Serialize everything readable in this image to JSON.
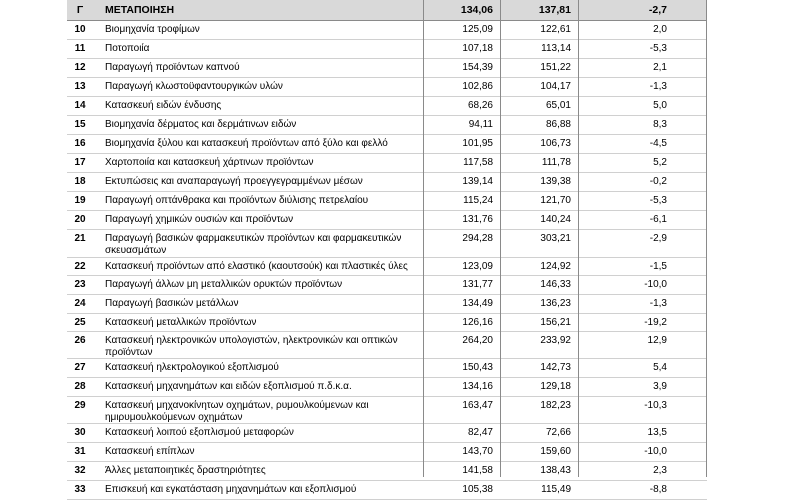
{
  "header": {
    "code": "Γ",
    "name": "ΜΕΤΑΠΟΙΗΣΗ",
    "v1": "134,06",
    "v2": "137,81",
    "v3": "-2,7"
  },
  "rows": [
    {
      "code": "10",
      "name": "Βιομηχανία τροφίμων",
      "v1": "125,09",
      "v2": "122,61",
      "v3": "2,0"
    },
    {
      "code": "11",
      "name": "Ποτοποιία",
      "v1": "107,18",
      "v2": "113,14",
      "v3": "-5,3"
    },
    {
      "code": "12",
      "name": "Παραγωγή προϊόντων καπνού",
      "v1": "154,39",
      "v2": "151,22",
      "v3": "2,1"
    },
    {
      "code": "13",
      "name": "Παραγωγή κλωστοϋφαντουργικών υλών",
      "v1": "102,86",
      "v2": "104,17",
      "v3": "-1,3"
    },
    {
      "code": "14",
      "name": "Κατασκευή ειδών ένδυσης",
      "v1": "68,26",
      "v2": "65,01",
      "v3": "5,0"
    },
    {
      "code": "15",
      "name": "Βιομηχανία δέρματος και δερμάτινων ειδών",
      "v1": "94,11",
      "v2": "86,88",
      "v3": "8,3"
    },
    {
      "code": "16",
      "name": "Βιομηχανία ξύλου και κατασκευή προϊόντων από ξύλο και φελλό",
      "v1": "101,95",
      "v2": "106,73",
      "v3": "-4,5"
    },
    {
      "code": "17",
      "name": "Χαρτοποιία και κατασκευή χάρτινων προϊόντων",
      "v1": "117,58",
      "v2": "111,78",
      "v3": "5,2"
    },
    {
      "code": "18",
      "name": "Εκτυπώσεις και αναπαραγωγή προεγγεγραμμένων μέσων",
      "v1": "139,14",
      "v2": "139,38",
      "v3": "-0,2"
    },
    {
      "code": "19",
      "name": "Παραγωγή οπτάνθρακα και προϊόντων διύλισης πετρελαίου",
      "v1": "115,24",
      "v2": "121,70",
      "v3": "-5,3"
    },
    {
      "code": "20",
      "name": "Παραγωγή χημικών ουσιών και προϊόντων",
      "v1": "131,76",
      "v2": "140,24",
      "v3": "-6,1"
    },
    {
      "code": "21",
      "name": "Παραγωγή βασικών φαρμακευτικών προϊόντων και φαρμακευτικών σκευασμάτων",
      "v1": "294,28",
      "v2": "303,21",
      "v3": "-2,9"
    },
    {
      "code": "22",
      "name": "Κατασκευή προϊόντων από ελαστικό (καουτσούκ) και πλαστικές ύλες",
      "v1": "123,09",
      "v2": "124,92",
      "v3": "-1,5"
    },
    {
      "code": "23",
      "name": "Παραγωγή άλλων μη μεταλλικών ορυκτών προϊόντων",
      "v1": "131,77",
      "v2": "146,33",
      "v3": "-10,0"
    },
    {
      "code": "24",
      "name": "Παραγωγή βασικών μετάλλων",
      "v1": "134,49",
      "v2": "136,23",
      "v3": "-1,3"
    },
    {
      "code": "25",
      "name": "Κατασκευή μεταλλικών προϊόντων",
      "v1": "126,16",
      "v2": "156,21",
      "v3": "-19,2"
    },
    {
      "code": "26",
      "name": "Κατασκευή ηλεκτρονικών υπολογιστών, ηλεκτρονικών και οπτικών προϊόντων",
      "v1": "264,20",
      "v2": "233,92",
      "v3": "12,9"
    },
    {
      "code": "27",
      "name": "Κατασκευή ηλεκτρολογικού εξοπλισμού",
      "v1": "150,43",
      "v2": "142,73",
      "v3": "5,4"
    },
    {
      "code": "28",
      "name": "Κατασκευή μηχανημάτων και ειδών εξοπλισμού π.δ.κ.α.",
      "v1": "134,16",
      "v2": "129,18",
      "v3": "3,9"
    },
    {
      "code": "29",
      "name": "Κατασκευή μηχανοκίνητων οχημάτων, ρυμουλκούμενων και ημιρυμουλκούμενων οχημάτων",
      "v1": "163,47",
      "v2": "182,23",
      "v3": "-10,3"
    },
    {
      "code": "30",
      "name": "Κατασκευή λοιπού εξοπλισμού μεταφορών",
      "v1": "82,47",
      "v2": "72,66",
      "v3": "13,5"
    },
    {
      "code": "31",
      "name": "Κατασκευή επίπλων",
      "v1": "143,70",
      "v2": "159,60",
      "v3": "-10,0"
    },
    {
      "code": "32",
      "name": "Άλλες μεταποιητικές δραστηριότητες",
      "v1": "141,58",
      "v2": "138,43",
      "v3": "2,3"
    },
    {
      "code": "33",
      "name": "Επισκευή και εγκατάσταση μηχανημάτων και εξοπλισμού",
      "v1": "105,38",
      "v2": "115,49",
      "v3": "-8,8"
    }
  ]
}
